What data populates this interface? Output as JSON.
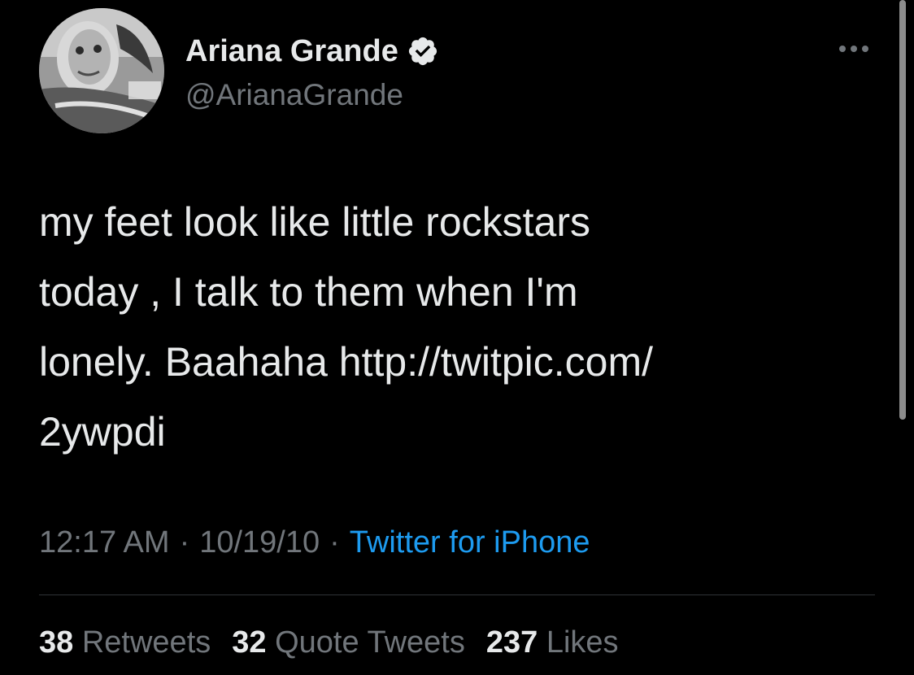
{
  "author": {
    "display_name": "Ariana Grande",
    "username": "@ArianaGrande",
    "verified_icon": "verified-badge-icon"
  },
  "tweet": {
    "lines": [
      "my feet look like little rockstars",
      "today , I talk to them when I'm",
      "lonely. Baahaha  http://twitpic.com/",
      "2ywpdi"
    ]
  },
  "meta": {
    "time": "12:17 AM",
    "date": "10/19/10",
    "separator": "·",
    "source": "Twitter for iPhone"
  },
  "stats": {
    "retweets": {
      "count": "38",
      "label": "Retweets"
    },
    "quotes": {
      "count": "32",
      "label": "Quote Tweets"
    },
    "likes": {
      "count": "237",
      "label": "Likes"
    }
  },
  "colors": {
    "background": "#000000",
    "primary_text": "#e7e9ea",
    "secondary_text": "#71767b",
    "link": "#1d9bf0",
    "divider": "#2f3336"
  }
}
